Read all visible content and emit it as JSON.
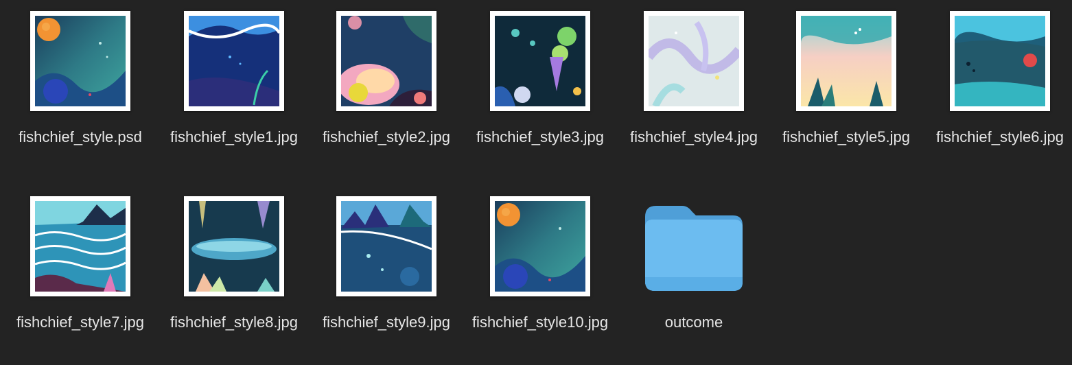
{
  "window": {
    "view": "icon-grid"
  },
  "files": [
    {
      "name": "fishchief_style.psd",
      "kind": "psd",
      "icon": "image-thumbnail"
    },
    {
      "name": "fishchief_style1.jpg",
      "kind": "jpg",
      "icon": "image-thumbnail"
    },
    {
      "name": "fishchief_style2.jpg",
      "kind": "jpg",
      "icon": "image-thumbnail"
    },
    {
      "name": "fishchief_style3.jpg",
      "kind": "jpg",
      "icon": "image-thumbnail"
    },
    {
      "name": "fishchief_style4.jpg",
      "kind": "jpg",
      "icon": "image-thumbnail"
    },
    {
      "name": "fishchief_style5.jpg",
      "kind": "jpg",
      "icon": "image-thumbnail"
    },
    {
      "name": "fishchief_style6.jpg",
      "kind": "jpg",
      "icon": "image-thumbnail"
    },
    {
      "name": "fishchief_style7.jpg",
      "kind": "jpg",
      "icon": "image-thumbnail"
    },
    {
      "name": "fishchief_style8.jpg",
      "kind": "jpg",
      "icon": "image-thumbnail"
    },
    {
      "name": "fishchief_style9.jpg",
      "kind": "jpg",
      "icon": "image-thumbnail"
    },
    {
      "name": "fishchief_style10.jpg",
      "kind": "jpg",
      "icon": "image-thumbnail"
    },
    {
      "name": "outcome",
      "kind": "folder",
      "icon": "folder-icon"
    }
  ],
  "colors": {
    "background": "#232323",
    "label": "#e6e6e6",
    "folder_front": "#6cbcf0",
    "folder_back": "#4f9fd8"
  }
}
